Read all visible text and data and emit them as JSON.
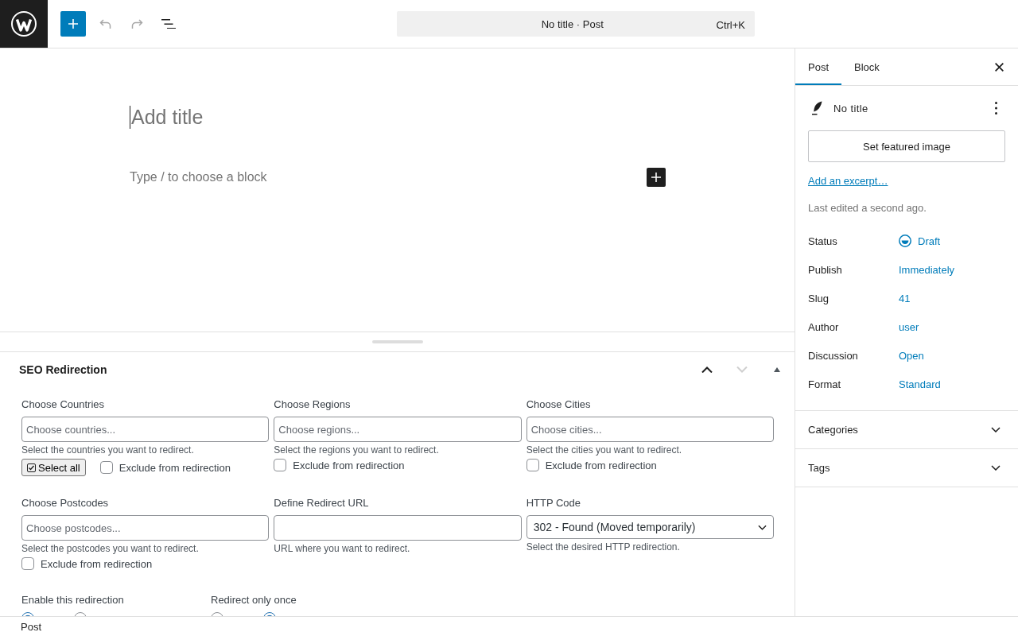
{
  "toolbar": [
    {
      "kind": "inserter",
      "disabled": false
    },
    {
      "kind": "undo",
      "disabled": true
    },
    {
      "kind": "redo",
      "disabled": true
    },
    {
      "kind": "list_view",
      "disabled": false
    }
  ],
  "document_bar": {
    "title": "No title · Post",
    "shortcut": "Ctrl+K"
  },
  "editor": {
    "title": {
      "placeholder": "Add title"
    },
    "block": {
      "placeholder": "Type / to choose a block"
    }
  },
  "meta_box": {
    "title": "SEO Redirection",
    "expanded": true,
    "move_buttons": [
      {
        "kind": "up",
        "disabled": false
      },
      {
        "kind": "down",
        "disabled": true
      }
    ],
    "fields": [
      {
        "kind": "multi",
        "label": "Choose Countries",
        "placeholder": "Choose countries...",
        "help": "Select the countries you want to redirect.",
        "select_all": "Select all",
        "exclude": {
          "label": "Exclude from redirection",
          "checked": false
        }
      },
      {
        "kind": "multi",
        "label": "Choose Regions",
        "placeholder": "Choose regions...",
        "help": "Select the regions you want to redirect.",
        "exclude": {
          "label": "Exclude from redirection",
          "checked": false
        }
      },
      {
        "kind": "multi",
        "label": "Choose Cities",
        "placeholder": "Choose cities...",
        "help": "Select the cities you want to redirect.",
        "exclude": {
          "label": "Exclude from redirection",
          "checked": false
        }
      },
      {
        "kind": "multi",
        "label": "Choose Postcodes",
        "placeholder": "Choose postcodes...",
        "help": "Select the postcodes you want to redirect.",
        "exclude": {
          "label": "Exclude from redirection",
          "checked": false
        }
      },
      {
        "kind": "text",
        "label": "Define Redirect URL",
        "help": "URL where you want to redirect."
      },
      {
        "kind": "select",
        "label": "HTTP Code",
        "value": "302 - Found (Moved temporarily)",
        "help": "Select the desired HTTP redirection."
      }
    ],
    "switches": [
      {
        "label": "Enable this redirection",
        "options": [
          {
            "selected": true
          },
          {
            "selected": false
          }
        ]
      },
      {
        "label": "Redirect only once",
        "options": [
          {
            "selected": false
          },
          {
            "selected": true
          }
        ]
      }
    ]
  },
  "sidebar": {
    "tabs": [
      {
        "label": "Post",
        "selected": true
      },
      {
        "label": "Block",
        "selected": false
      }
    ],
    "post_title": "No title",
    "featured_image_button": "Set featured image",
    "excerpt_link": "Add an excerpt…",
    "last_edited": "Last edited a second ago.",
    "properties": [
      {
        "kind": "status",
        "label": "Status",
        "value": "Draft"
      },
      {
        "kind": "link",
        "label": "Publish",
        "value": "Immediately"
      },
      {
        "kind": "link",
        "label": "Slug",
        "value": "41"
      },
      {
        "kind": "link",
        "label": "Author",
        "value": "user"
      },
      {
        "kind": "link",
        "label": "Discussion",
        "value": "Open"
      },
      {
        "kind": "link",
        "label": "Format",
        "value": "Standard"
      }
    ],
    "panels": [
      {
        "title": "Categories",
        "expanded": false
      },
      {
        "title": "Tags",
        "expanded": false
      }
    ]
  },
  "footer": {
    "breadcrumb": "Post"
  }
}
